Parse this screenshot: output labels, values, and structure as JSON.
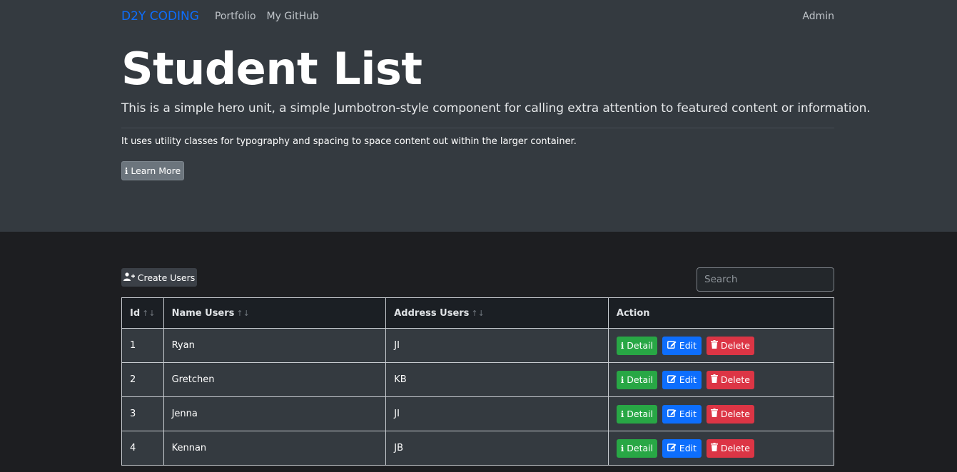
{
  "nav": {
    "brand": "D2Y CODING",
    "links": [
      "Portfolio",
      "My GitHub"
    ],
    "user": "Admin"
  },
  "hero": {
    "title": "Student List",
    "lead": "This is a simple hero unit, a simple Jumbotron-style component for calling extra attention to featured content or information.",
    "sub": "It uses utility classes for typography and spacing to space content out within the larger container.",
    "learn_more": "Learn More"
  },
  "toolbar": {
    "create_label": "Create Users",
    "search_placeholder": "Search"
  },
  "table": {
    "headers": [
      "Id",
      "Name Users",
      "Address Users",
      "Action"
    ],
    "rows": [
      {
        "id": "1",
        "name": "Ryan",
        "address": "JI"
      },
      {
        "id": "2",
        "name": "Gretchen",
        "address": "KB"
      },
      {
        "id": "3",
        "name": "Jenna",
        "address": "JI"
      },
      {
        "id": "4",
        "name": "Kennan",
        "address": "JB"
      }
    ],
    "actions": {
      "detail": "Detail",
      "edit": "Edit",
      "delete": "Delete"
    }
  },
  "icons": {
    "learn": "info-icon",
    "create": "user-plus-icon",
    "detail": "info-icon",
    "edit": "edit-icon",
    "delete": "trash-icon",
    "sort": "sort-icon"
  }
}
